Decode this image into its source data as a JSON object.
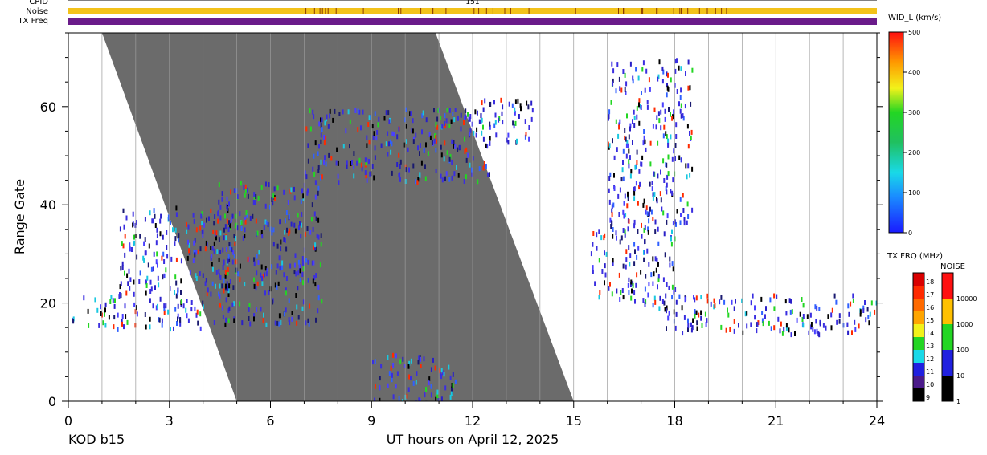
{
  "header": {
    "cpid_label": "CPID",
    "cpid_value": "151",
    "noise_label": "Noise",
    "txfreq_label": "TX Freq"
  },
  "footer": {
    "station": "KOD b15",
    "xlabel": "UT hours on April 12, 2025"
  },
  "colors": {
    "background_shade": "#6b6b6b",
    "noise_strip": "#f3c21a",
    "txfreq_strip": "#6a1b8a",
    "scatter_main": "#3a2ee0",
    "scatter_dark": "#1a1a70"
  },
  "chart_data": {
    "type": "heatmap",
    "xlabel": "UT hours on April 12, 2025",
    "ylabel": "Range Gate",
    "xlim": [
      0,
      24
    ],
    "ylim": [
      0,
      75
    ],
    "xticks": [
      "0",
      "3",
      "6",
      "9",
      "12",
      "15",
      "18",
      "21",
      "24"
    ],
    "yticks": [
      "0",
      "20",
      "40",
      "60"
    ],
    "vertical_gridlines_every_hours": 1,
    "ground_scatter_region": {
      "description": "gray band (ground scatter flag)",
      "left_edge": [
        [
          1.0,
          75
        ],
        [
          5.0,
          0
        ]
      ],
      "right_edge": [
        [
          10.9,
          75
        ],
        [
          15.0,
          0
        ]
      ]
    },
    "echo_bands": [
      {
        "x": [
          0.1,
          4.0
        ],
        "y": [
          15,
          22
        ],
        "note": "low-range echoes morning"
      },
      {
        "x": [
          1.5,
          5.0
        ],
        "y": [
          22,
          40
        ]
      },
      {
        "x": [
          4.3,
          7.5
        ],
        "y": [
          16,
          45
        ]
      },
      {
        "x": [
          7.0,
          12.5
        ],
        "y": [
          45,
          60
        ]
      },
      {
        "x": [
          12.0,
          13.8
        ],
        "y": [
          53,
          62
        ]
      },
      {
        "x": [
          15.5,
          18.0
        ],
        "y": [
          20,
          36
        ]
      },
      {
        "x": [
          17.5,
          24.0
        ],
        "y": [
          14,
          22
        ]
      },
      {
        "x": [
          16.0,
          18.5
        ],
        "y": [
          36,
          70
        ]
      },
      {
        "x": [
          9.0,
          11.5
        ],
        "y": [
          0,
          10
        ]
      }
    ],
    "velocity_colorbar": {
      "title": "WID_L (km/s)",
      "ticks": [
        "0",
        "100",
        "200",
        "300",
        "400",
        "500"
      ],
      "range": [
        0,
        500
      ]
    },
    "txfreq_colorbar": {
      "title": "TX FRQ (MHz)",
      "ticks": [
        "9",
        "10",
        "11",
        "12",
        "13",
        "14",
        "15",
        "16",
        "17",
        "18"
      ],
      "colors": [
        "#000000",
        "#4b1a8a",
        "#2020e0",
        "#19d9e8",
        "#23d623",
        "#f2f21a",
        "#ffa500",
        "#ff6a00",
        "#ff2a00",
        "#d90000"
      ]
    },
    "noise_colorbar": {
      "title": "NOISE",
      "ticks": [
        "1",
        "10",
        "100",
        "1000",
        "10000"
      ],
      "colors": [
        "#000000",
        "#2020e0",
        "#23d623",
        "#ffc000",
        "#ff1010"
      ]
    }
  }
}
